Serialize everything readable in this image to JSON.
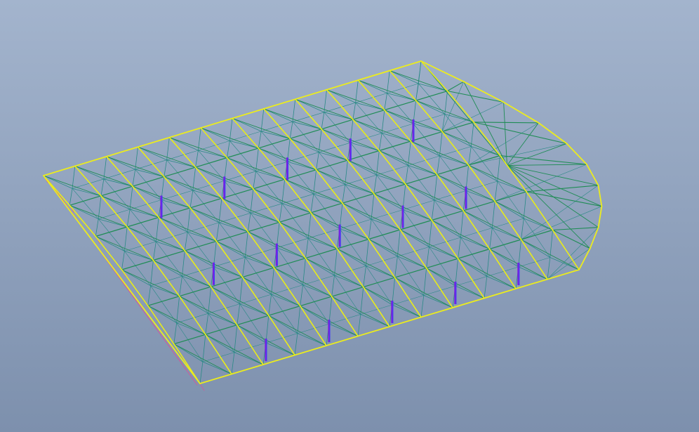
{
  "viewport": {
    "background_top": "#a3b4cd",
    "background_bottom": "#7d90ad"
  },
  "model": {
    "type": "space-frame-roof",
    "member_colors": {
      "edge": "#ecec1e",
      "chord": "#1f8c55",
      "web": "#2a8a86",
      "support": "#7a1fe0",
      "support_highlight": "#3a3aff",
      "side": "#d05a9a"
    },
    "icons": {
      "support_marker": "column-support-icon"
    }
  }
}
